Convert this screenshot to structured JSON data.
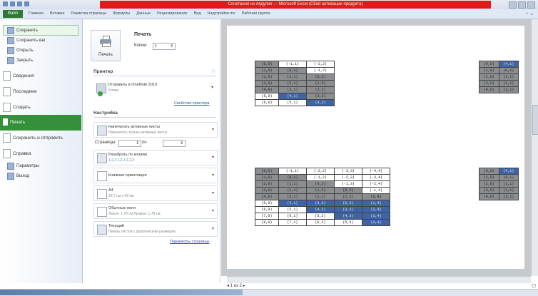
{
  "window": {
    "title": "Сочетания из ледулик — Microsoft Excel (Сбой активации продукта)"
  },
  "ribbon": {
    "file_tab": "Файл",
    "tabs": [
      "Главная",
      "Вставка",
      "Разметка страницы",
      "Формулы",
      "Данные",
      "Рецензирование",
      "Вид",
      "Надстройки mv",
      "Рабочая группа"
    ]
  },
  "backstage": {
    "items": [
      "Сохранить",
      "Сохранить как",
      "Открыть",
      "Закрыть",
      "Сведения",
      "Последние",
      "Создать",
      "Печать",
      "Сохранить и отправить",
      "Справка",
      "Параметры",
      "Выход"
    ],
    "selected": "Печать"
  },
  "print": {
    "title": "Печать",
    "print_button": "Печать",
    "copies_label": "Копии:",
    "copies_value": "1",
    "printer_header": "Принтер",
    "printer_name": "Отправить в OneNote 2010",
    "printer_status": "Готово",
    "printer_props_link": "Свойства принтера",
    "settings_header": "Настройка",
    "scope_l1": "Напечатать активные листы",
    "scope_l2": "Напечатать только активные листы",
    "pages_label": "Страницы:",
    "pages_to": "по",
    "collate_l1": "Разобрать по копиям",
    "collate_l2": "1,2,3   1,2,3   1,2,3",
    "orientation": "Книжная ориентация",
    "paper_l1": "A4",
    "paper_l2": "20,7 см x 42 см",
    "margins_l1": "Обычные поля",
    "margins_l2": "Левое: 1,78 см   Правое: 1,78 см",
    "scaling_l1": "Текущий",
    "scaling_l2": "Печать листов с фактическим размером",
    "page_setup_link": "Параметры страницы"
  },
  "preview": {
    "nav_label": "1",
    "nav_of": "из 2",
    "tables": [
      {
        "rows": [
          [
            [
              "(0,0)",
              "g"
            ],
            [
              "(-1,1)",
              "w"
            ],
            [
              "(-2,2)",
              "w"
            ]
          ],
          [
            [
              "(1,0)",
              "g"
            ],
            [
              "(0,1)",
              "g"
            ],
            [
              "(-1,2)",
              "w"
            ]
          ],
          [
            [
              "(2,0)",
              "g"
            ],
            [
              "(1,1)",
              "g"
            ],
            [
              "(0,2)",
              "g"
            ]
          ],
          [
            [
              "(3,0)",
              "g"
            ],
            [
              "(2,1)",
              "g"
            ],
            [
              "(1,2)",
              "g"
            ]
          ],
          [
            [
              "(4,0)",
              "g"
            ],
            [
              "(3,1)",
              "g"
            ],
            [
              "(2,2)",
              "g"
            ]
          ],
          [
            [
              "(5,0)",
              "w"
            ],
            [
              "(4,1)",
              "b"
            ],
            [
              "(3,2)",
              "g"
            ]
          ],
          [
            [
              "(6,0)",
              "w"
            ],
            [
              "(5,1)",
              "w"
            ],
            [
              "(4,2)",
              "b"
            ]
          ]
        ]
      },
      {
        "rows": [
          [
            [
              "(0,0)",
              "g"
            ],
            [
              "(4,1)",
              "b"
            ]
          ],
          [
            [
              "(1,0)",
              "g"
            ],
            [
              "(0,1)",
              "g"
            ]
          ],
          [
            [
              "(2,0)",
              "g"
            ],
            [
              "(1,1)",
              "g"
            ]
          ],
          [
            [
              "(3,0)",
              "g"
            ],
            [
              "(2,1)",
              "g"
            ]
          ],
          [
            [
              "(4,0)",
              "g"
            ],
            [
              "(3,1)",
              "g"
            ]
          ]
        ]
      },
      {
        "rows": [
          [
            [
              "(0,0)",
              "g"
            ],
            [
              "(-1,1)",
              "w"
            ],
            [
              "(-2,2)",
              "w"
            ],
            [
              "(-3,3)",
              "w"
            ],
            [
              "(-4,4)",
              "w"
            ]
          ],
          [
            [
              "(1,0)",
              "g"
            ],
            [
              "(0,1)",
              "g"
            ],
            [
              "(-1,2)",
              "w"
            ],
            [
              "(-2,3)",
              "w"
            ],
            [
              "(-3,4)",
              "w"
            ]
          ],
          [
            [
              "(2,0)",
              "g"
            ],
            [
              "(1,1)",
              "g"
            ],
            [
              "(0,2)",
              "g"
            ],
            [
              "(-1,3)",
              "w"
            ],
            [
              "(-2,4)",
              "w"
            ]
          ],
          [
            [
              "(3,0)",
              "g"
            ],
            [
              "(2,1)",
              "g"
            ],
            [
              "(1,2)",
              "g"
            ],
            [
              "(0,3)",
              "g"
            ],
            [
              "(-1,4)",
              "w"
            ]
          ],
          [
            [
              "(4,0)",
              "g"
            ],
            [
              "(3,1)",
              "g"
            ],
            [
              "(2,2)",
              "g"
            ],
            [
              "(1,3)",
              "g"
            ],
            [
              "(0,4)",
              "g"
            ]
          ],
          [
            [
              "(5,0)",
              "w"
            ],
            [
              "(4,1)",
              "b"
            ],
            [
              "(3,2)",
              "b"
            ],
            [
              "(2,3)",
              "b"
            ],
            [
              "(1,4)",
              "b"
            ]
          ],
          [
            [
              "(6,0)",
              "w"
            ],
            [
              "(5,1)",
              "w"
            ],
            [
              "(4,2)",
              "b"
            ],
            [
              "(3,3)",
              "b"
            ],
            [
              "(2,4)",
              "b"
            ]
          ],
          [
            [
              "(7,0)",
              "w"
            ],
            [
              "(6,1)",
              "w"
            ],
            [
              "(5,2)",
              "w"
            ],
            [
              "(4,3)",
              "b"
            ],
            [
              "(3,4)",
              "b"
            ]
          ],
          [
            [
              "(8,0)",
              "w"
            ],
            [
              "(7,1)",
              "w"
            ],
            [
              "(6,2)",
              "w"
            ],
            [
              "(5,3)",
              "w"
            ],
            [
              "(4,4)",
              "b"
            ]
          ]
        ]
      },
      {
        "rows": [
          [
            [
              "(0,0)",
              "g"
            ],
            [
              "(4,1)",
              "b"
            ]
          ],
          [
            [
              "(1,0)",
              "g"
            ],
            [
              "(0,1)",
              "g"
            ]
          ],
          [
            [
              "(2,0)",
              "g"
            ],
            [
              "(1,1)",
              "g"
            ]
          ],
          [
            [
              "(3,0)",
              "g"
            ],
            [
              "(2,1)",
              "g"
            ]
          ],
          [
            [
              "(4,0)",
              "g"
            ],
            [
              "(3,1)",
              "g"
            ]
          ]
        ]
      }
    ]
  }
}
